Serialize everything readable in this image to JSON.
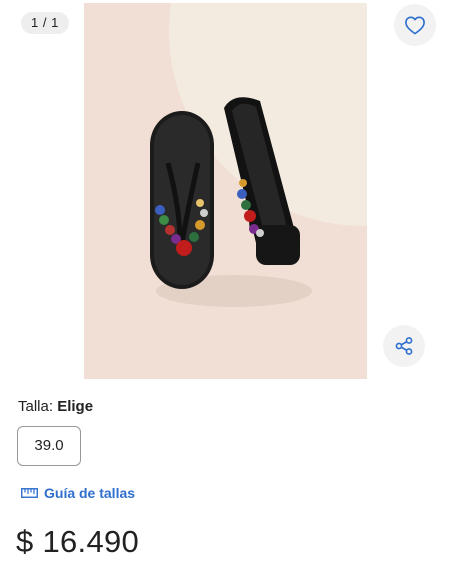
{
  "gallery": {
    "counter": "1 / 1",
    "product_image": "jeweled-wedge-flip-flops"
  },
  "icons": {
    "favorite": "heart-icon",
    "share": "share-icon",
    "size_guide": "ruler-icon"
  },
  "size": {
    "label": "Talla:",
    "prompt": "Elige",
    "options": [
      "39.0"
    ]
  },
  "size_guide": {
    "label": "Guía de tallas"
  },
  "price": {
    "text": "$ 16.490"
  },
  "colors": {
    "accent": "#2f6fce",
    "image_background": "#f3e2d8",
    "button_background": "#f2f2f2"
  }
}
